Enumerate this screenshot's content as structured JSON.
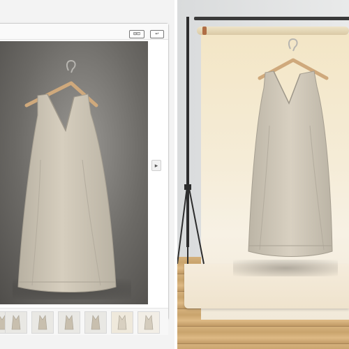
{
  "toolbar": {
    "left_button_label": "⊟⊡",
    "right_button_label": "↩",
    "side_scroll_glyph": "▸"
  },
  "icons": {
    "hanger": "hanger-icon",
    "dress": "linen-dress-image"
  },
  "colors": {
    "dress": "#c8bfae",
    "photo_backdrop": "#6c6a66",
    "studio_backdrop": "#f3e6c6",
    "floor": "#c9a46d"
  },
  "thumbnails": [
    {
      "name": "thumb-1",
      "background": "#e9e8e4"
    },
    {
      "name": "thumb-2",
      "background": "#e9e8e4"
    },
    {
      "name": "thumb-3",
      "background": "#e9e8e4"
    },
    {
      "name": "thumb-4",
      "background": "#e9e8e4"
    },
    {
      "name": "thumb-5",
      "background": "#e9e8e4"
    },
    {
      "name": "thumb-6",
      "background": "#efe9dc"
    },
    {
      "name": "thumb-7",
      "background": "#f2eee6"
    }
  ]
}
